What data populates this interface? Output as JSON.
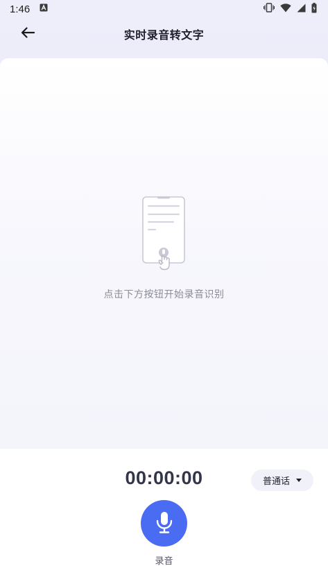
{
  "status_bar": {
    "time": "1:46",
    "icons": [
      "font-notification-icon",
      "vibrate-icon",
      "wifi-icon",
      "signal-icon",
      "battery-icon"
    ]
  },
  "header": {
    "title": "实时录音转文字",
    "back_icon": "arrow-left-icon"
  },
  "empty_state": {
    "illustration_icon": "phone-mic-tap-icon",
    "hint": "点击下方按钮开始录音识别"
  },
  "recorder": {
    "timer": "00:00:00",
    "language": "普通话",
    "record_label": "录音",
    "accent_color": "#4a6cf2"
  }
}
